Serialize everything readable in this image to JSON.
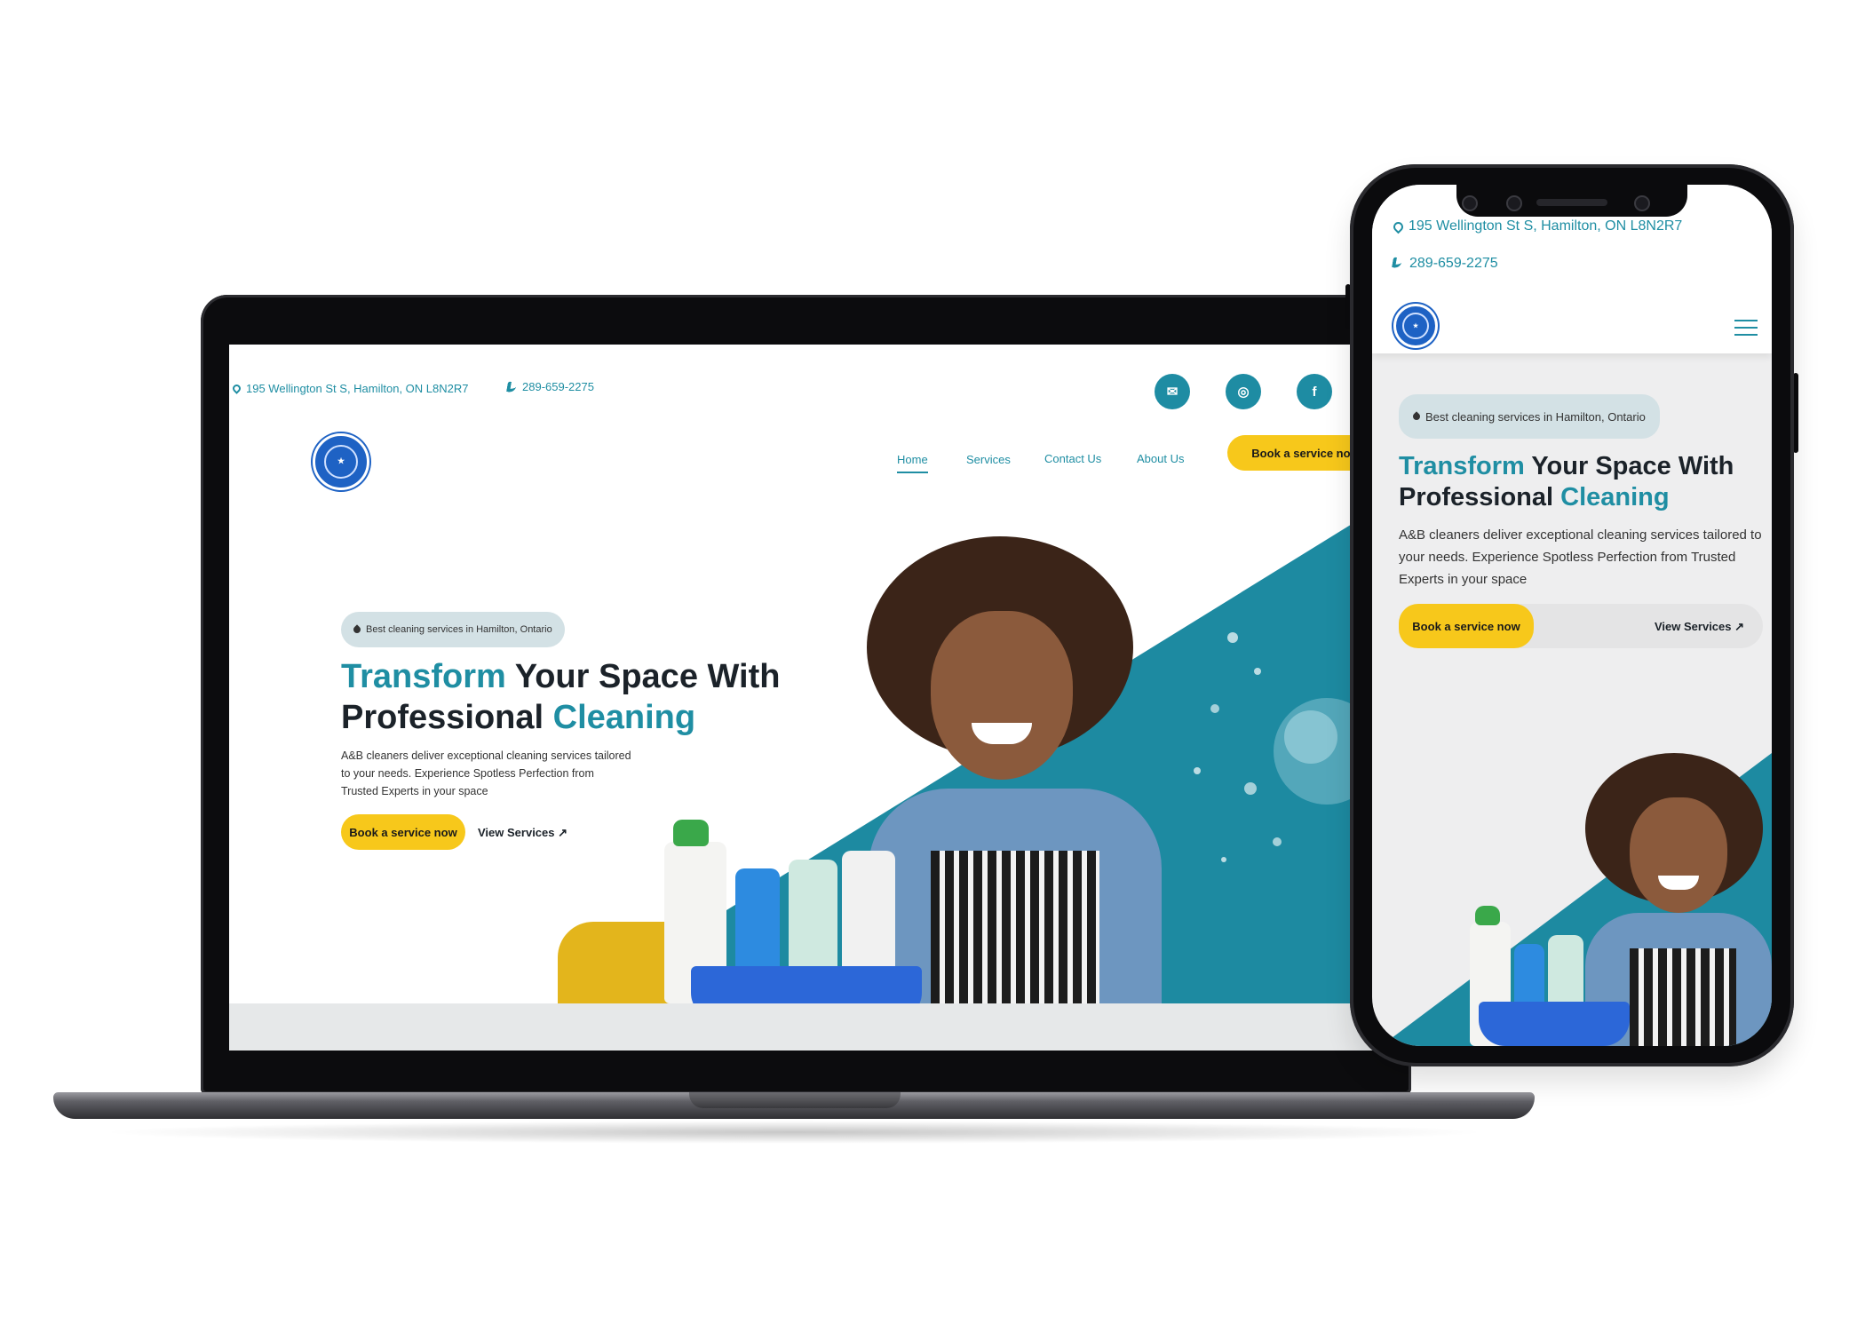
{
  "contact": {
    "address": "195 Wellington St S, Hamilton, ON L8N2R7",
    "phone": "289-659-2275"
  },
  "social": [
    {
      "name": "email",
      "glyph": "✉"
    },
    {
      "name": "instagram",
      "glyph": "◎"
    },
    {
      "name": "facebook",
      "glyph": "f"
    }
  ],
  "nav": {
    "items": [
      "Home",
      "Services",
      "Contact Us",
      "About Us"
    ],
    "cta": "Book a service now"
  },
  "hero": {
    "badge": "Best cleaning services in Hamilton, Ontario",
    "title_teal_1": "Transform",
    "title_dark_1": " Your Space With",
    "title_dark_2": "Professional ",
    "title_teal_2": "Cleaning",
    "description": "A&B cleaners deliver exceptional cleaning services tailored to your needs. Experience Spotless Perfection from Trusted Experts in your space",
    "primary_button": "Book a service now",
    "secondary_button": "View Services ↗"
  },
  "colors": {
    "brand_teal": "#1f8ea3",
    "cta_yellow": "#f7c81b",
    "logo_blue": "#1e62c4"
  },
  "icons": {
    "address": "map-pin-icon",
    "phone": "phone-icon",
    "menu": "hamburger-menu-icon",
    "badge": "water-drop-icon"
  }
}
